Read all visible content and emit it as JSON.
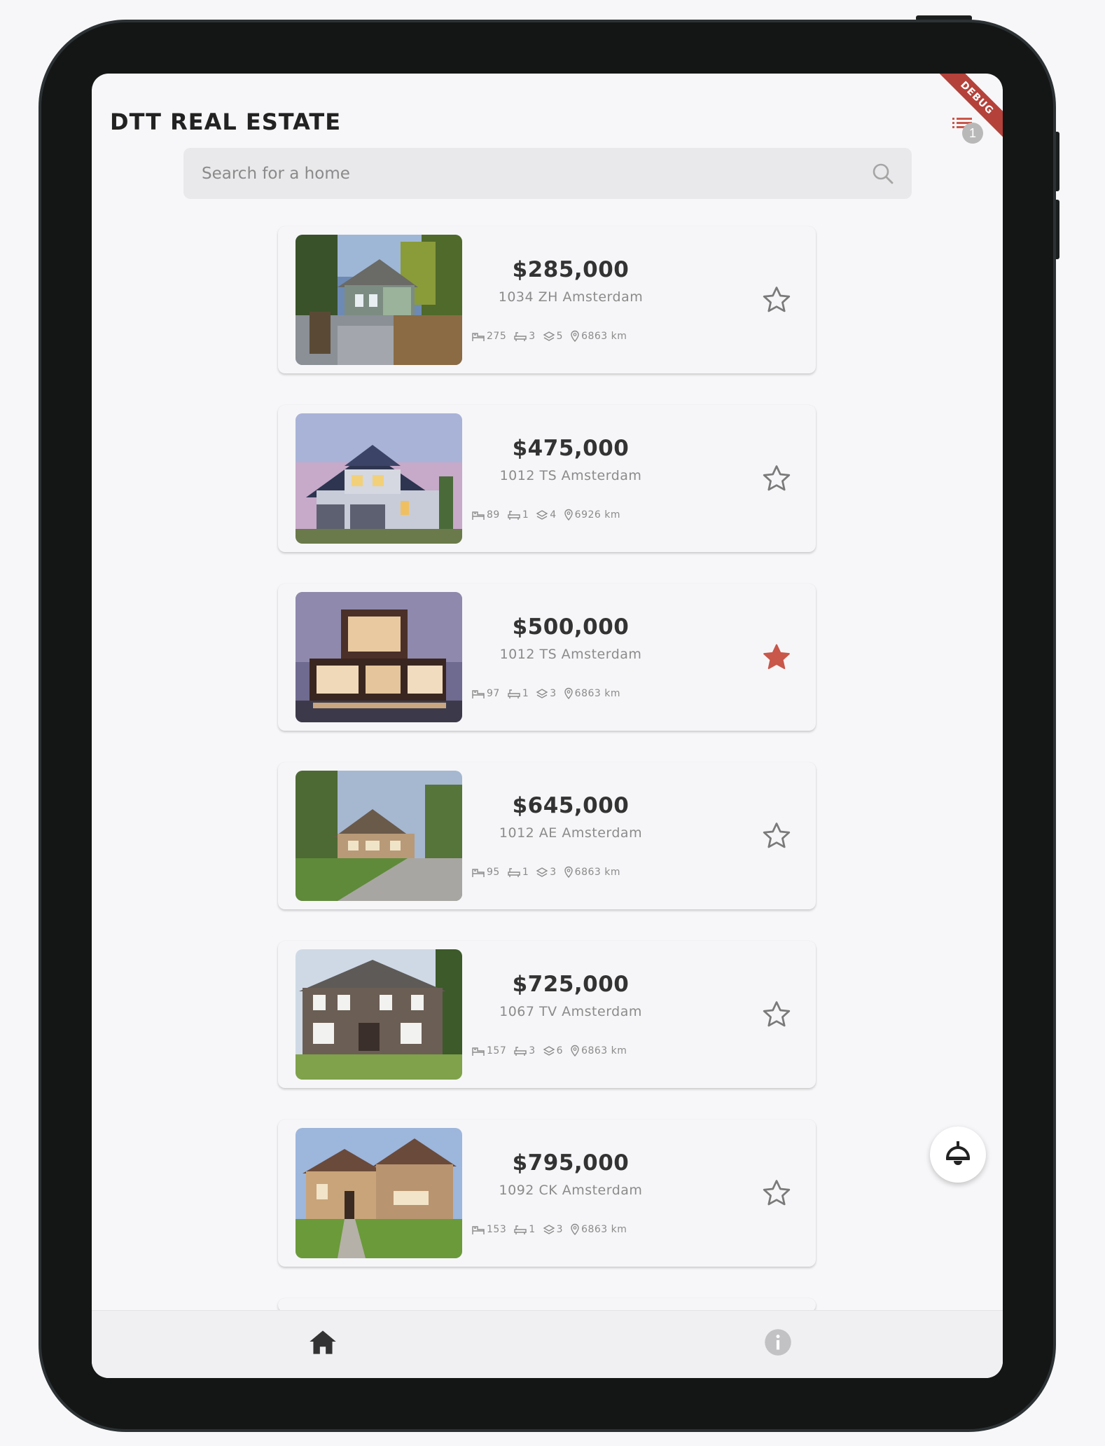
{
  "app": {
    "title": "DTT REAL ESTATE",
    "debug_banner": "DEBUG",
    "filter_count": "1"
  },
  "search": {
    "placeholder": "Search for a home"
  },
  "listings": [
    {
      "price": "$285,000",
      "zip": "1034 ZH Amsterdam",
      "size": "275",
      "bathrooms": "3",
      "floors": "5",
      "distance": "6863 km",
      "favorite": false
    },
    {
      "price": "$475,000",
      "zip": "1012 TS Amsterdam",
      "size": "89",
      "bathrooms": "1",
      "floors": "4",
      "distance": "6926 km",
      "favorite": false
    },
    {
      "price": "$500,000",
      "zip": "1012 TS Amsterdam",
      "size": "97",
      "bathrooms": "1",
      "floors": "3",
      "distance": "6863 km",
      "favorite": true
    },
    {
      "price": "$645,000",
      "zip": "1012 AE Amsterdam",
      "size": "95",
      "bathrooms": "1",
      "floors": "3",
      "distance": "6863 km",
      "favorite": false
    },
    {
      "price": "$725,000",
      "zip": "1067 TV Amsterdam",
      "size": "157",
      "bathrooms": "3",
      "floors": "6",
      "distance": "6863 km",
      "favorite": false
    },
    {
      "price": "$795,000",
      "zip": "1092 CK Amsterdam",
      "size": "153",
      "bathrooms": "1",
      "floors": "3",
      "distance": "6863 km",
      "favorite": false
    }
  ],
  "colors": {
    "accent": "#c9574a",
    "text_primary": "#333333",
    "text_secondary": "#8b8b8b",
    "icon_inactive": "#7a7a7a"
  },
  "icons": {
    "filter": "filter-list-icon",
    "search": "search-icon",
    "size": "bed-icon",
    "bathrooms": "bath-icon",
    "floors": "layers-icon",
    "distance": "location-pin-icon",
    "favorite": "star-icon",
    "fab": "lamp-icon",
    "nav_home": "home-icon",
    "nav_info": "info-icon"
  }
}
